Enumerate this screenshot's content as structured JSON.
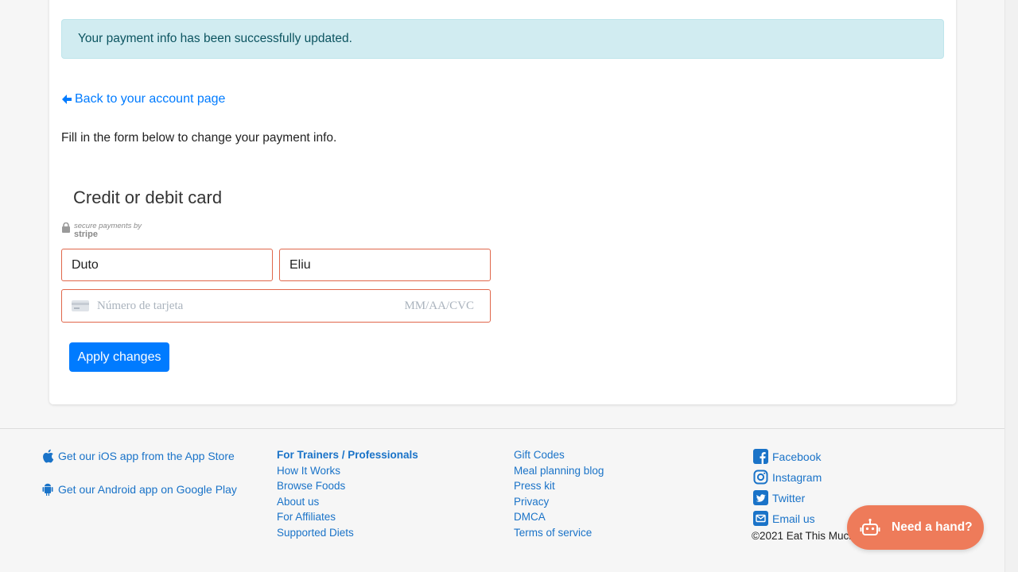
{
  "alert": {
    "message": "Your payment info has been successfully updated."
  },
  "back_link": {
    "label": "Back to your account page"
  },
  "intro": "Fill in the form below to change your payment info.",
  "card_section": {
    "title": "Credit or debit card",
    "stripe_badge_small": "secure payments by",
    "stripe_badge_brand": "stripe",
    "first_name_value": "Duto",
    "last_name_value": "Eliu",
    "card_number_placeholder": "Número de tarjeta",
    "expiry_cvc_placeholder": "MM/AA/CVC",
    "apply_label": "Apply changes"
  },
  "footer": {
    "apps": [
      {
        "label": "Get our iOS app from the App Store",
        "icon": "apple-icon"
      },
      {
        "label": "Get our Android app on Google Play",
        "icon": "android-icon"
      }
    ],
    "col1": [
      "For Trainers / Professionals",
      "How It Works",
      "Browse Foods",
      "About us",
      "For Affiliates",
      "Supported Diets"
    ],
    "col2": [
      "Gift Codes",
      "Meal planning blog",
      "Press kit",
      "Privacy",
      "DMCA",
      "Terms of service"
    ],
    "social": [
      {
        "label": "Facebook",
        "icon": "facebook-icon"
      },
      {
        "label": "Instagram",
        "icon": "instagram-icon"
      },
      {
        "label": "Twitter",
        "icon": "twitter-icon"
      },
      {
        "label": "Email us",
        "icon": "email-icon"
      }
    ],
    "copyright": "©2021 Eat This Much"
  },
  "help_button": {
    "label": "Need a hand?"
  },
  "colors": {
    "accent": "#007bff",
    "alert_bg": "#d1ecf1",
    "field_border": "#e0664a",
    "help_bg": "#ee7b5a"
  }
}
